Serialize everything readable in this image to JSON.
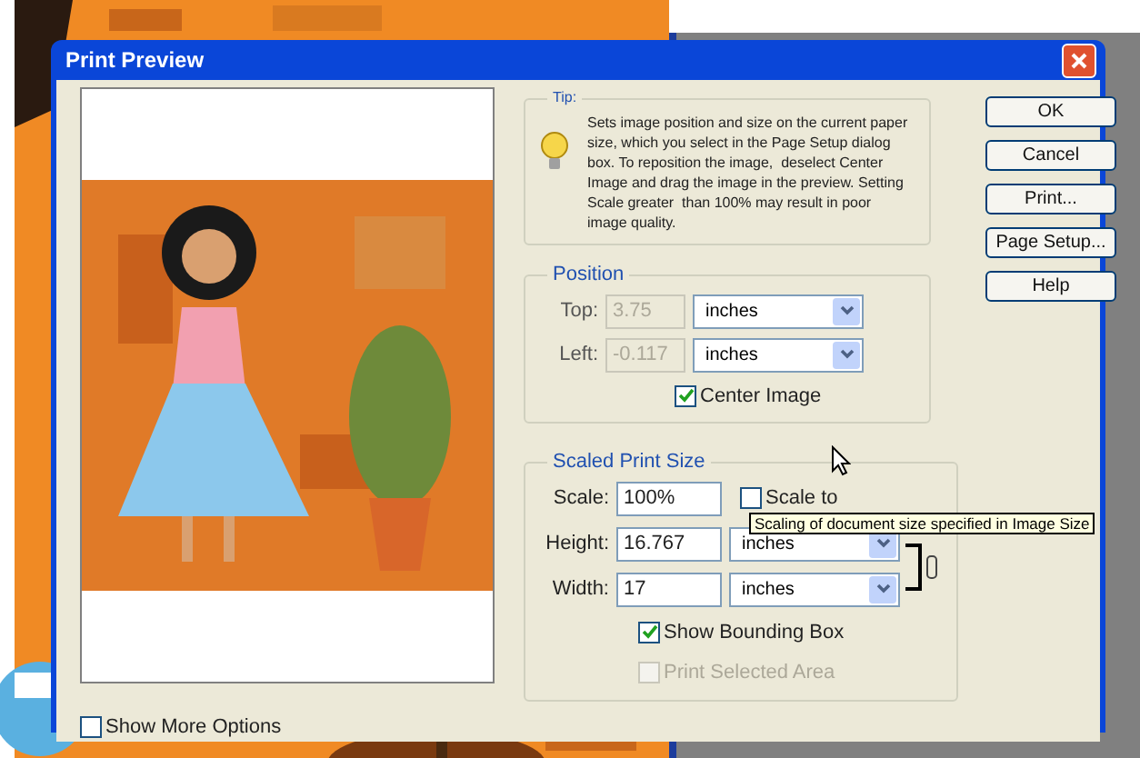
{
  "window": {
    "title": "Print Preview"
  },
  "tip": {
    "title": "Tip:",
    "text": "Sets image position and size on the current paper  size, which you select in the Page Setup dialog box. To reposition the image,  deselect Center Image and drag the image in the preview. Setting Scale greater  than 100% may result in poor image quality."
  },
  "position": {
    "title": "Position",
    "fields": [
      {
        "label": "Top:",
        "value": "3.75",
        "unit": "inches",
        "disabled": true
      },
      {
        "label": "Left:",
        "value": "-0.117",
        "unit": "inches",
        "disabled": true
      }
    ],
    "center_image": {
      "label": "Center Image",
      "checked": true
    }
  },
  "scaled_print_size": {
    "title": "Scaled Print Size",
    "scale": {
      "label": "Scale:",
      "value": "100%"
    },
    "scale_to_fit": {
      "label": "Scale to",
      "checked": false
    },
    "fields": [
      {
        "label": "Height:",
        "value": "16.767",
        "unit": "inches"
      },
      {
        "label": "Width:",
        "value": "17",
        "unit": "inches"
      }
    ],
    "options": [
      {
        "label": "Show Bounding Box",
        "checked": true,
        "disabled": false
      },
      {
        "label": "Print Selected Area",
        "checked": false,
        "disabled": true
      }
    ]
  },
  "buttons": [
    "OK",
    "Cancel",
    "Print...",
    "Page Setup...",
    "Help"
  ],
  "show_more_options": {
    "label": "Show More Options",
    "checked": false
  },
  "tooltip": {
    "text": "Scaling of document size specified in Image Size"
  }
}
